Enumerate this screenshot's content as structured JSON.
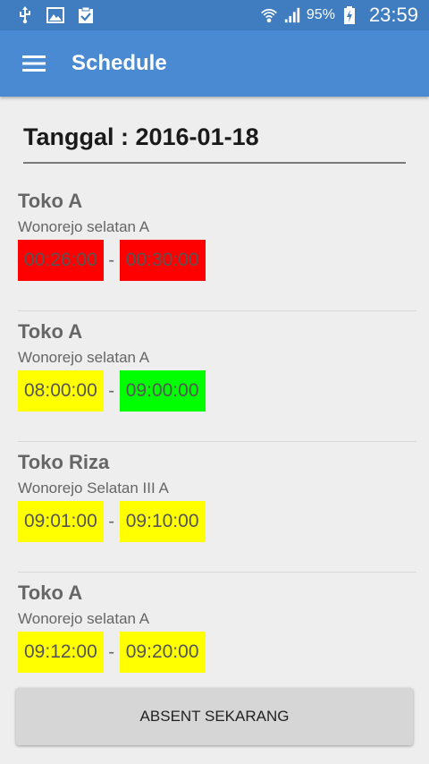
{
  "status_bar": {
    "battery_text": "95%",
    "time": "23:59"
  },
  "toolbar": {
    "title": "Schedule"
  },
  "date_label": "Tanggal : 2016-01-18",
  "colors": {
    "red": "#ff0000",
    "yellow": "#ffff00",
    "green": "#00ff00",
    "toolbar": "#4a8ad2",
    "status_bar": "#3f7cc0"
  },
  "entries": [
    {
      "name": "Toko A",
      "address": "Wonorejo selatan A",
      "start": "00:26:00",
      "end": "00:30:00",
      "start_color": "#ff0000",
      "end_color": "#ff0000"
    },
    {
      "name": "Toko A",
      "address": "Wonorejo selatan A",
      "start": "08:00:00",
      "end": "09:00:00",
      "start_color": "#ffff00",
      "end_color": "#00ff00"
    },
    {
      "name": "Toko Riza",
      "address": "Wonorejo Selatan III A",
      "start": "09:01:00",
      "end": "09:10:00",
      "start_color": "#ffff00",
      "end_color": "#ffff00"
    },
    {
      "name": "Toko A",
      "address": "Wonorejo selatan A",
      "start": "09:12:00",
      "end": "09:20:00",
      "start_color": "#ffff00",
      "end_color": "#ffff00"
    }
  ],
  "separator": "-",
  "action_button": "ABSENT SEKARANG"
}
